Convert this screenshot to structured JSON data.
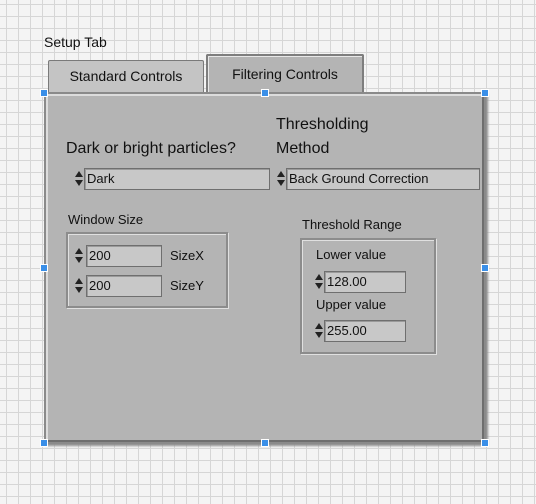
{
  "setup_tab": {
    "title": "Setup Tab",
    "tabs": [
      {
        "label": "Standard Controls",
        "active": false
      },
      {
        "label": "Filtering Controls",
        "active": true
      }
    ]
  },
  "filtering": {
    "particles_label": "Dark or bright particles?",
    "particles_value": "Dark",
    "threshold_method_label_line1": "Thresholding",
    "threshold_method_label_line2": "Method",
    "threshold_method_value": "Back Ground Correction",
    "window_size": {
      "title": "Window Size",
      "sizex_value": "200",
      "sizex_label": "SizeX",
      "sizey_value": "200",
      "sizey_label": "SizeY"
    },
    "threshold_range": {
      "title": "Threshold Range",
      "lower_label": "Lower value",
      "lower_value": "128.00",
      "upper_label": "Upper value",
      "upper_value": "255.00"
    }
  },
  "colors": {
    "panel": "#b4b4b4",
    "selection_handle": "#3a8fe8",
    "grid": "#d6d6d6"
  }
}
